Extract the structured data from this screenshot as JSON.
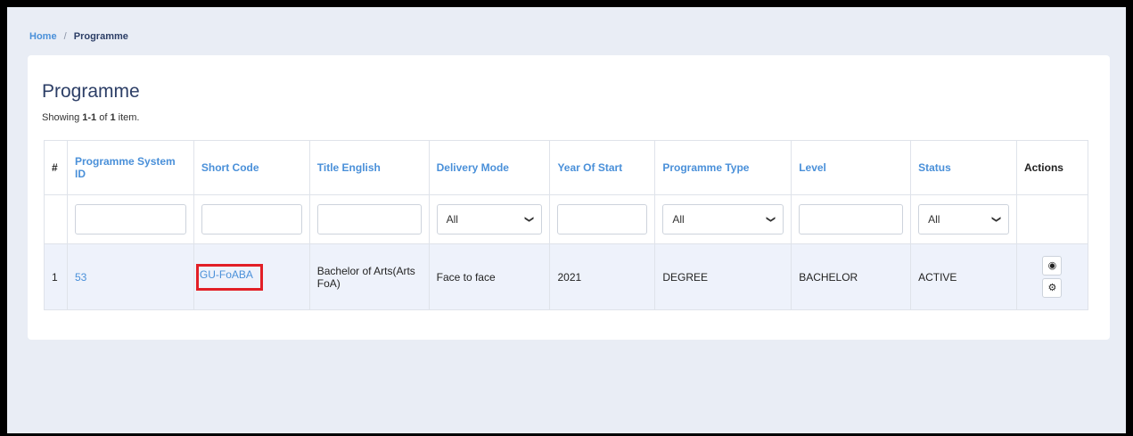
{
  "breadcrumb": {
    "home": "Home",
    "separator": "/",
    "current": "Programme"
  },
  "page": {
    "title": "Programme",
    "summary_prefix": "Showing ",
    "summary_range": "1-1",
    "summary_mid": " of ",
    "summary_total": "1",
    "summary_suffix": " item."
  },
  "table": {
    "headers": [
      "#",
      "Programme System ID",
      "Short Code",
      "Title English",
      "Delivery Mode",
      "Year Of Start",
      "Programme Type",
      "Level",
      "Status",
      "Actions"
    ],
    "filters": {
      "delivery_mode": "All",
      "programme_type": "All",
      "status": "All"
    },
    "rows": [
      {
        "index": "1",
        "system_id": "53",
        "short_code": "GU-FoABA",
        "title": "Bachelor of Arts(Arts FoA)",
        "delivery_mode": "Face to face",
        "year_of_start": "2021",
        "programme_type": "DEGREE",
        "level": "BACHELOR",
        "status": "ACTIVE"
      }
    ]
  },
  "icons": {
    "view": "eye-icon",
    "settings": "gear-icon",
    "dropdown": "chevron-down-icon"
  },
  "colors": {
    "link": "#4a90d9",
    "highlight": "#e21f26",
    "background": "#e9edf5"
  }
}
